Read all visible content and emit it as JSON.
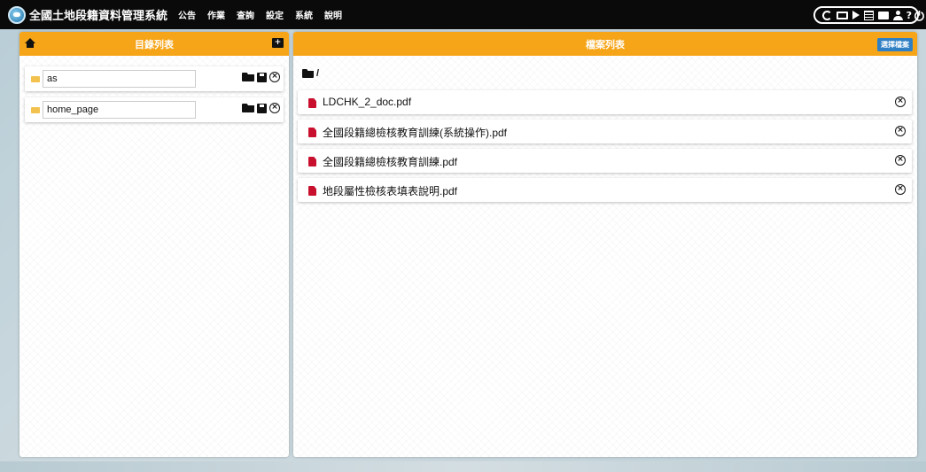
{
  "app": {
    "title": "全國土地段籍資料管理系統"
  },
  "menu": {
    "items": [
      "公告",
      "作業",
      "查詢",
      "設定",
      "系統",
      "說明"
    ]
  },
  "toolbar": {
    "icons": [
      "refresh-icon",
      "monitor-icon",
      "play-icon",
      "list-icon",
      "chat-icon",
      "user-icon",
      "help-icon",
      "power-icon"
    ],
    "help_label": "?",
    "power_label": "⏻"
  },
  "left_panel": {
    "title": "目錄列表",
    "directories": [
      {
        "name": "as"
      },
      {
        "name": "home_page"
      }
    ]
  },
  "right_panel": {
    "title": "檔案列表",
    "select_button_label": "選擇檔案",
    "current_path": "/",
    "files": [
      {
        "name": "LDCHK_2_doc.pdf"
      },
      {
        "name": "全國段籍總檢核教育訓練(系統操作).pdf"
      },
      {
        "name": "全國段籍總檢核教育訓練.pdf"
      },
      {
        "name": "地段屬性檢核表填表說明.pdf"
      }
    ]
  },
  "colors": {
    "header": "#f7a518",
    "topbar": "#0a0a0a",
    "select_button": "#2f7fc4",
    "pdf_icon": "#c8102e",
    "folder_icon": "#f2c14e"
  }
}
